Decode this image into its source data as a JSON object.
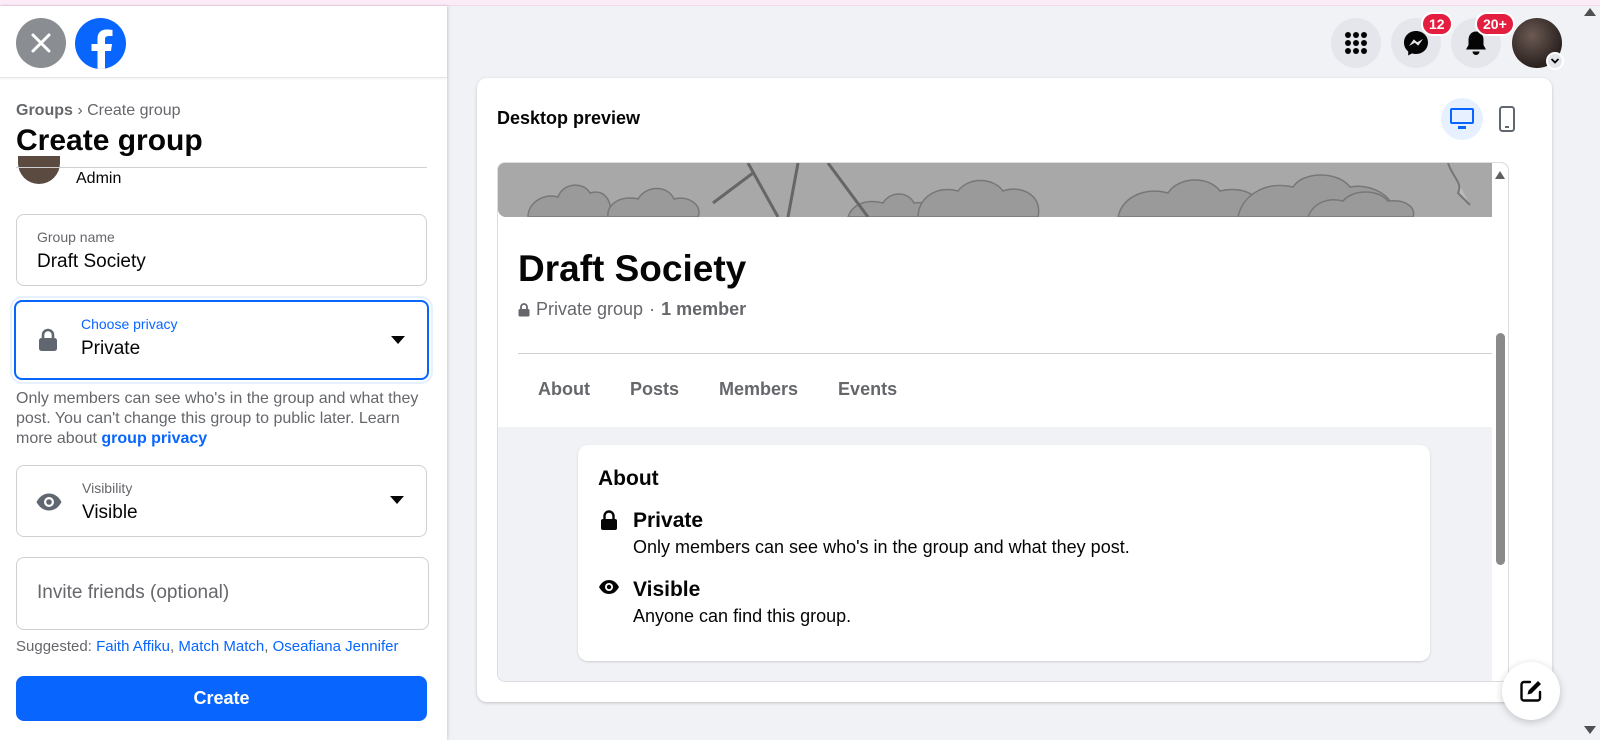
{
  "left_panel": {
    "breadcrumb": {
      "root": "Groups",
      "separator": "›",
      "current": "Create group"
    },
    "page_title": "Create group",
    "admin_label": "Admin",
    "group_name_field": {
      "label": "Group name",
      "value": "Draft Society"
    },
    "privacy_field": {
      "label": "Choose privacy",
      "value": "Private"
    },
    "privacy_help": {
      "text": "Only members can see who's in the group and what they post. You can't change this group to public later. Learn more about ",
      "link": "group privacy"
    },
    "visibility_field": {
      "label": "Visibility",
      "value": "Visible"
    },
    "invite_field": {
      "placeholder": "Invite friends (optional)"
    },
    "suggested": {
      "label": "Suggested:",
      "names": [
        "Faith Affiku",
        "Match Match",
        "Oseafiana Jennifer"
      ]
    },
    "create_button": "Create"
  },
  "top_actions": {
    "messenger_badge": "12",
    "notifications_badge": "20+"
  },
  "preview": {
    "title": "Desktop preview",
    "group_name": "Draft Society",
    "group_privacy": "Private group",
    "meta_separator": "·",
    "member_count": "1 member",
    "tabs": [
      "About",
      "Posts",
      "Members",
      "Events"
    ],
    "about": {
      "title": "About",
      "privacy_title": "Private",
      "privacy_desc": "Only members can see who's in the group and what they post.",
      "visibility_title": "Visible",
      "visibility_desc": "Anyone can find this group."
    }
  },
  "colors": {
    "accent": "#0866ff",
    "badge": "#e41e3f",
    "background": "#f0f2f5"
  }
}
